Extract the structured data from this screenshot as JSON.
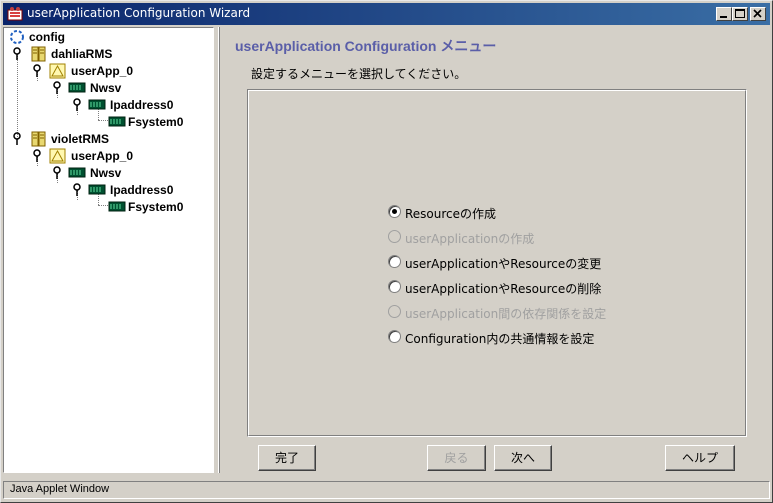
{
  "window": {
    "title": "userApplication Configuration Wizard"
  },
  "tree": {
    "root": {
      "label": "config",
      "icon": "config-ring-icon"
    },
    "nodes": [
      {
        "label": "dahliaRMS",
        "icon": "host-icon"
      },
      {
        "label": "userApp_0",
        "icon": "userapp-warning-icon"
      },
      {
        "label": "Nwsv",
        "icon": "resource-icon"
      },
      {
        "label": "Ipaddress0",
        "icon": "resource-icon"
      },
      {
        "label": "Fsystem0",
        "icon": "resource-icon"
      },
      {
        "label": "violetRMS",
        "icon": "host-icon"
      },
      {
        "label": "userApp_0",
        "icon": "userapp-warning-icon"
      },
      {
        "label": "Nwsv",
        "icon": "resource-icon"
      },
      {
        "label": "Ipaddress0",
        "icon": "resource-icon"
      },
      {
        "label": "Fsystem0",
        "icon": "resource-icon"
      }
    ]
  },
  "main": {
    "header": "userApplication Configuration メニュー",
    "instruction": "設定するメニューを選択してください。",
    "options": [
      {
        "label": "Resourceの作成",
        "selected": true,
        "enabled": true
      },
      {
        "label": "userApplicationの作成",
        "selected": false,
        "enabled": false
      },
      {
        "label": "userApplicationやResourceの変更",
        "selected": false,
        "enabled": true
      },
      {
        "label": "userApplicationやResourceの削除",
        "selected": false,
        "enabled": true
      },
      {
        "label": "userApplication間の依存関係を設定",
        "selected": false,
        "enabled": false
      },
      {
        "label": "Configuration内の共通情報を設定",
        "selected": false,
        "enabled": true
      }
    ]
  },
  "buttons": {
    "finish": "完了",
    "back": "戻る",
    "next": "次へ",
    "help": "ヘルプ"
  },
  "status": {
    "text": "Java Applet Window"
  },
  "colors": {
    "title_bar_start": "#0a246a",
    "title_bar_end": "#3a6ea5",
    "header_text": "#5a5ea8",
    "face": "#d4d0c8"
  }
}
